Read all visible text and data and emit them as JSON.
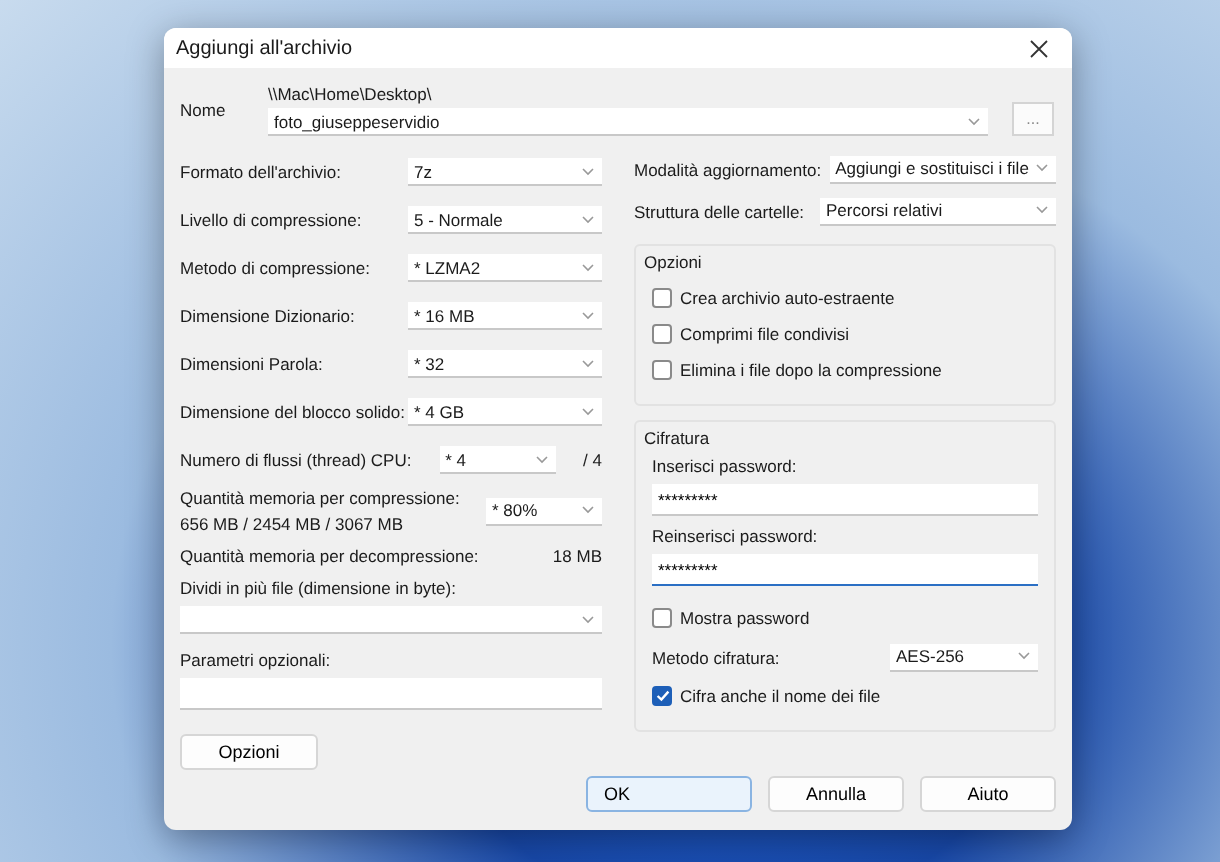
{
  "window": {
    "title": "Aggiungi all'archivio"
  },
  "name": {
    "label": "Nome",
    "path": "\\\\Mac\\Home\\Desktop\\",
    "value": "foto_giuseppeservidio",
    "browse": "..."
  },
  "left_fields": [
    {
      "label": "Formato dell'archivio:",
      "value": "7z"
    },
    {
      "label": "Livello di compressione:",
      "value": "5 - Normale"
    },
    {
      "label": "Metodo di compressione:",
      "value": "* LZMA2"
    },
    {
      "label": "Dimensione Dizionario:",
      "value": "* 16 MB"
    },
    {
      "label": "Dimensioni Parola:",
      "value": "* 32"
    },
    {
      "label": "Dimensione del blocco solido:",
      "value": "* 4 GB"
    }
  ],
  "threads": {
    "label": "Numero di flussi (thread) CPU:",
    "value": "* 4",
    "max": "/ 4"
  },
  "memory": {
    "label": "Quantità memoria per compressione:",
    "detail": "656 MB / 2454 MB / 3067 MB",
    "value": "* 80%"
  },
  "decompression": {
    "label": "Quantità memoria per decompressione:",
    "value": "18 MB"
  },
  "split": {
    "label": "Dividi in più file (dimensione in byte):"
  },
  "params": {
    "label": "Parametri opzionali:"
  },
  "options_button": "Opzioni",
  "right_fields": [
    {
      "label": "Modalità aggiornamento:",
      "value": "Aggiungi e sostituisci i file"
    },
    {
      "label": "Struttura delle cartelle:",
      "value": "Percorsi relativi"
    }
  ],
  "options_group": {
    "title": "Opzioni",
    "items": [
      {
        "label": "Crea archivio auto-estraente",
        "checked": false
      },
      {
        "label": "Comprimi file condivisi",
        "checked": false
      },
      {
        "label": "Elimina i file dopo la compressione",
        "checked": false
      }
    ]
  },
  "encryption": {
    "title": "Cifratura",
    "passwords": [
      {
        "label": "Inserisci password:",
        "value": "*********",
        "focused": false
      },
      {
        "label": "Reinserisci password:",
        "value": "*********",
        "focused": true
      }
    ],
    "show_password": {
      "label": "Mostra password",
      "checked": false
    },
    "method": {
      "label": "Metodo cifratura:",
      "value": "AES-256"
    },
    "encrypt_names": {
      "label": "Cifra anche il nome dei file",
      "checked": true
    }
  },
  "buttons": [
    {
      "label": "OK",
      "default": true
    },
    {
      "label": "Annulla",
      "default": false
    },
    {
      "label": "Aiuto",
      "default": false
    }
  ]
}
